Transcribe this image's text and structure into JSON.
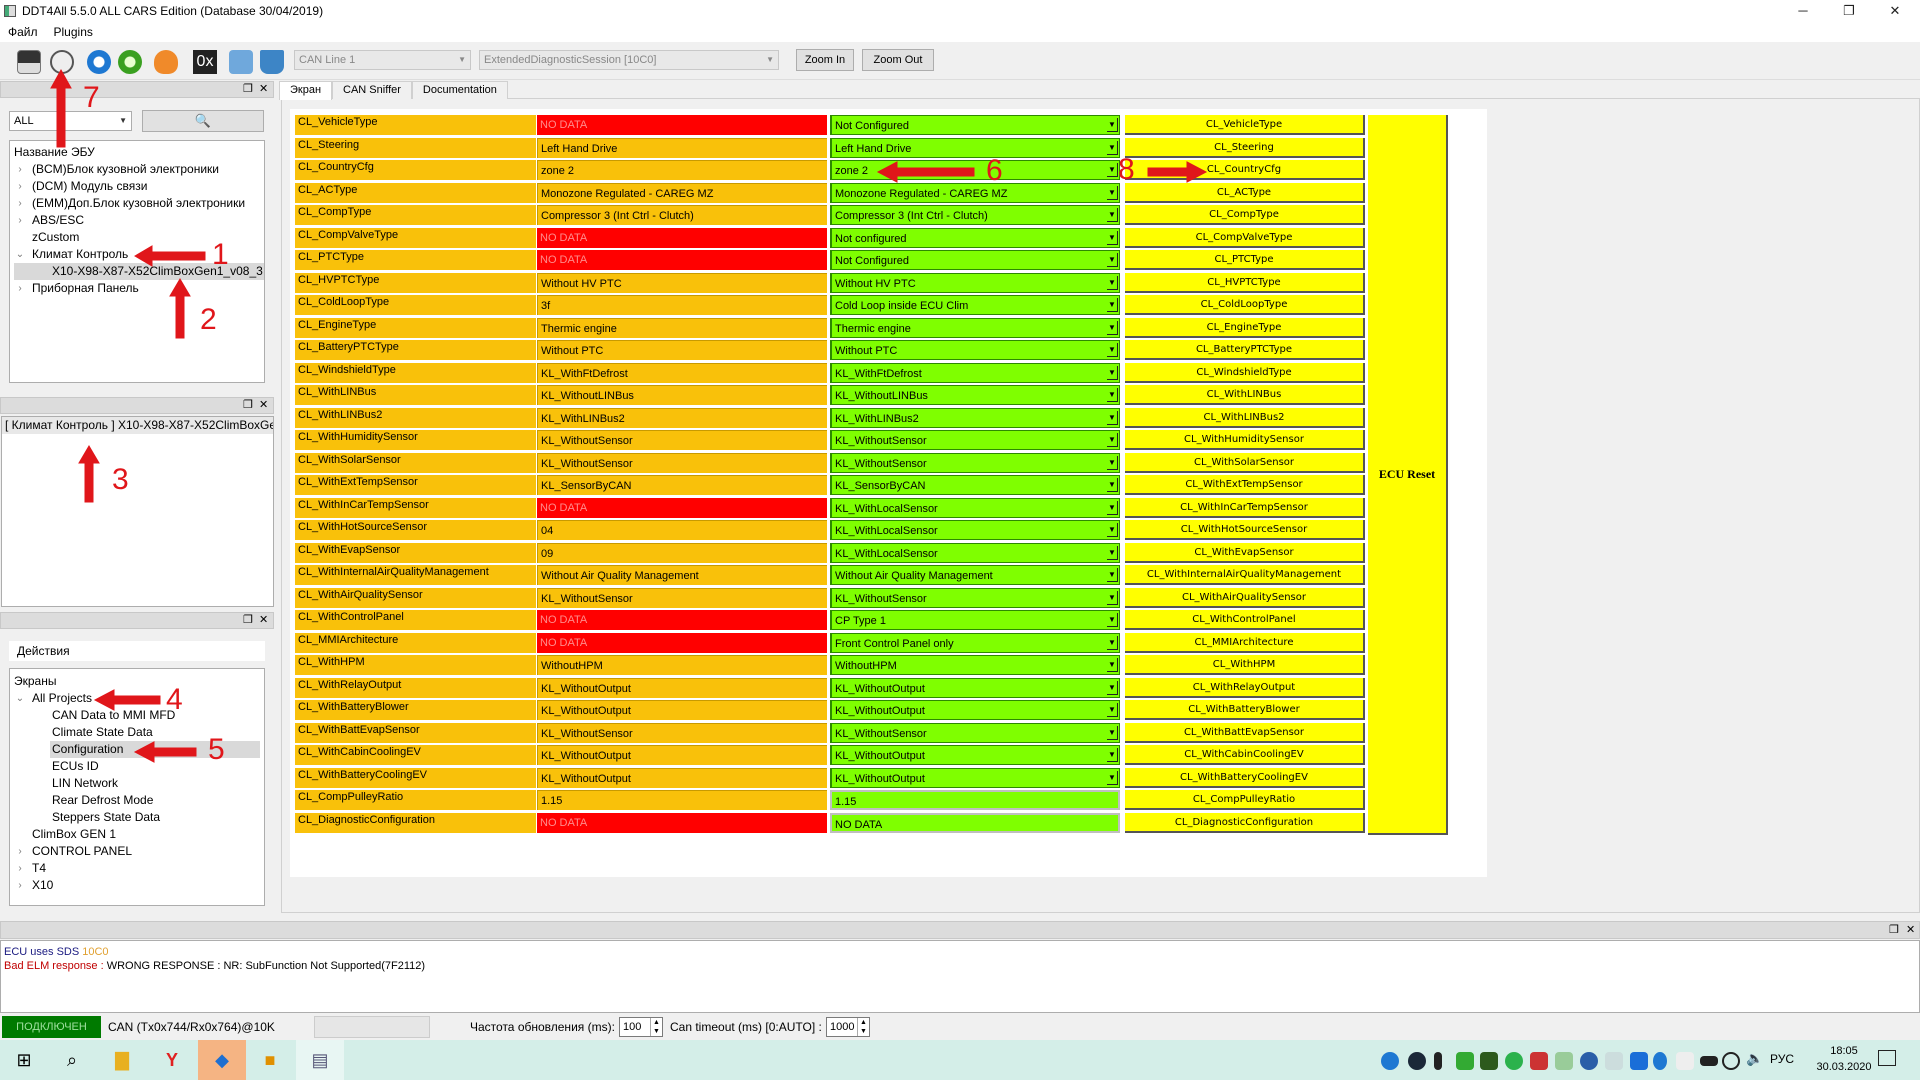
{
  "window": {
    "title": "DDT4All 5.5.0 ALL CARS Edition (Database 30/04/2019)",
    "minimize": "─",
    "maximize": "❐",
    "close": "✕"
  },
  "menu": [
    "Файл",
    "Plugins"
  ],
  "toolbar": {
    "icons": [
      "connect-monitor-icon",
      "scan-ecu-icon",
      "refresh-icon",
      "sync-icon",
      "heart-monitor-icon",
      "hex-icon",
      "settings-hand-icon",
      "valve-icon"
    ],
    "hex_label": "0x",
    "can_line": "CAN Line 1",
    "session": "ExtendedDiagnosticSession [10C0]",
    "zoom_in": "Zoom In",
    "zoom_out": "Zoom Out"
  },
  "ecu_dock": {
    "filter": "ALL",
    "header": "Название ЭБУ",
    "items": [
      {
        "label": "(BCM)Блок кузовной электроники",
        "expander": "›"
      },
      {
        "label": "(DCM) Модуль связи",
        "expander": "›"
      },
      {
        "label": "(EMM)Доп.Блок кузовной электроники",
        "expander": "›"
      },
      {
        "label": "ABS/ESC",
        "expander": "›"
      },
      {
        "label": "zCustom",
        "expander": ""
      },
      {
        "label": "Климат Контроль",
        "expander": "⌄"
      },
      {
        "label": "X10-X98-X87-X52ClimBoxGen1_v08_3",
        "expander": ""
      },
      {
        "label": "Приборная Панель",
        "expander": "›"
      }
    ]
  },
  "info_dock": {
    "text": "[ Климат Контроль ] X10-X98-X87-X52ClimBoxGen1_v08_3"
  },
  "actions_dock": {
    "header": "Действия",
    "tree_header": "Экраны",
    "items": [
      {
        "label": "All Projects",
        "expander": "⌄"
      },
      {
        "label": "CAN Data to MMI MFD",
        "expander": ""
      },
      {
        "label": "Climate State Data",
        "expander": ""
      },
      {
        "label": "Configuration",
        "expander": ""
      },
      {
        "label": "ECUs ID",
        "expander": ""
      },
      {
        "label": "LIN Network",
        "expander": ""
      },
      {
        "label": "Rear Defrost Mode",
        "expander": ""
      },
      {
        "label": "Steppers State Data",
        "expander": ""
      },
      {
        "label": "ClimBox GEN 1",
        "expander": ""
      },
      {
        "label": "CONTROL PANEL",
        "expander": "›"
      },
      {
        "label": "T4",
        "expander": "›"
      },
      {
        "label": "X10",
        "expander": "›"
      }
    ]
  },
  "tabs": [
    "Экран",
    "CAN Sniffer",
    "Documentation"
  ],
  "screen": {
    "ecu_reset": "ECU Reset",
    "rows": [
      {
        "name": "CL_VehicleType",
        "value": "NO DATA",
        "setting": "Not Configured"
      },
      {
        "name": "CL_Steering",
        "value": "Left Hand Drive",
        "setting": "Left Hand Drive"
      },
      {
        "name": "CL_CountryCfg",
        "value": "zone 2",
        "setting": "zone 2"
      },
      {
        "name": "CL_ACType",
        "value": "Monozone Regulated -  CAREG MZ",
        "setting": "Monozone Regulated -  CAREG MZ"
      },
      {
        "name": "CL_CompType",
        "value": "Compressor 3 (Int Ctrl - Clutch)",
        "setting": "Compressor 3 (Int Ctrl - Clutch)"
      },
      {
        "name": "CL_CompValveType",
        "value": "NO DATA",
        "setting": "Not configured"
      },
      {
        "name": "CL_PTCType",
        "value": "NO DATA",
        "setting": "Not Configured"
      },
      {
        "name": "CL_HVPTCType",
        "value": "Without HV PTC",
        "setting": "Without HV PTC"
      },
      {
        "name": "CL_ColdLoopType",
        "value": "3f",
        "setting": "Cold Loop inside ECU Clim"
      },
      {
        "name": "CL_EngineType",
        "value": "Thermic engine",
        "setting": "Thermic engine"
      },
      {
        "name": "CL_BatteryPTCType",
        "value": "Without PTC",
        "setting": "Without PTC"
      },
      {
        "name": "CL_WindshieldType",
        "value": "KL_WithFtDefrost",
        "setting": "KL_WithFtDefrost"
      },
      {
        "name": "CL_WithLINBus",
        "value": "KL_WithoutLINBus",
        "setting": "KL_WithoutLINBus"
      },
      {
        "name": "CL_WithLINBus2",
        "value": "KL_WithLINBus2",
        "setting": "KL_WithLINBus2"
      },
      {
        "name": "CL_WithHumiditySensor",
        "value": "KL_WithoutSensor",
        "setting": "KL_WithoutSensor"
      },
      {
        "name": "CL_WithSolarSensor",
        "value": "KL_WithoutSensor",
        "setting": "KL_WithoutSensor"
      },
      {
        "name": "CL_WithExtTempSensor",
        "value": "KL_SensorByCAN",
        "setting": "KL_SensorByCAN"
      },
      {
        "name": "CL_WithInCarTempSensor",
        "value": "NO DATA",
        "setting": "KL_WithLocalSensor"
      },
      {
        "name": "CL_WithHotSourceSensor",
        "value": "04",
        "setting": "KL_WithLocalSensor"
      },
      {
        "name": "CL_WithEvapSensor",
        "value": "09",
        "setting": "KL_WithLocalSensor"
      },
      {
        "name": "CL_WithInternalAirQualityManagement",
        "value": "Without Air Quality Management",
        "setting": "Without Air Quality Management"
      },
      {
        "name": "CL_WithAirQualitySensor",
        "value": "KL_WithoutSensor",
        "setting": "KL_WithoutSensor"
      },
      {
        "name": "CL_WithControlPanel",
        "value": "NO DATA",
        "setting": "CP Type 1"
      },
      {
        "name": "CL_MMIArchitecture",
        "value": "NO DATA",
        "setting": "Front Control Panel only"
      },
      {
        "name": "CL_WithHPM",
        "value": "WithoutHPM",
        "setting": "WithoutHPM"
      },
      {
        "name": "CL_WithRelayOutput",
        "value": "KL_WithoutOutput",
        "setting": "KL_WithoutOutput"
      },
      {
        "name": "CL_WithBatteryBlower",
        "value": "KL_WithoutOutput",
        "setting": "KL_WithoutOutput"
      },
      {
        "name": "CL_WithBattEvapSensor",
        "value": "KL_WithoutSensor",
        "setting": "KL_WithoutSensor"
      },
      {
        "name": "CL_WithCabinCoolingEV",
        "value": "KL_WithoutOutput",
        "setting": "KL_WithoutOutput"
      },
      {
        "name": "CL_WithBatteryCoolingEV",
        "value": "KL_WithoutOutput",
        "setting": "KL_WithoutOutput"
      },
      {
        "name": "CL_CompPulleyRatio",
        "value": "1.15",
        "setting": "1.15",
        "input": true
      },
      {
        "name": "CL_DiagnosticConfiguration",
        "value": "NO DATA",
        "setting": "NO DATA",
        "input": true
      }
    ]
  },
  "log": {
    "line1_prefix": "ECU uses SDS ",
    "line1_code": "10C0",
    "line2_prefix": "Bad ELM response : ",
    "line2_text": "WRONG RESPONSE : NR: SubFunction Not Supported(7F2112)"
  },
  "status": {
    "connected": "ПОДКЛЮЧЕН",
    "can_info": "CAN (Tx0x744/Rx0x764)@10K",
    "refresh_label": "Частота обновления (ms):",
    "refresh_value": "100",
    "timeout_label": "Can timeout (ms) [0:AUTO] :",
    "timeout_value": "1000"
  },
  "taskbar": {
    "lang": "РУС",
    "time": "18:05",
    "date": "30.03.2020"
  },
  "annotations": [
    "1",
    "2",
    "3",
    "4",
    "5",
    "6",
    "7",
    "8"
  ],
  "colors": {
    "name_cell": "#f9c10a",
    "no_data": "#ff0000",
    "setting": "#7fff00",
    "button": "#ffff00",
    "connected": "#007a00",
    "annotation": "#e0161a"
  }
}
